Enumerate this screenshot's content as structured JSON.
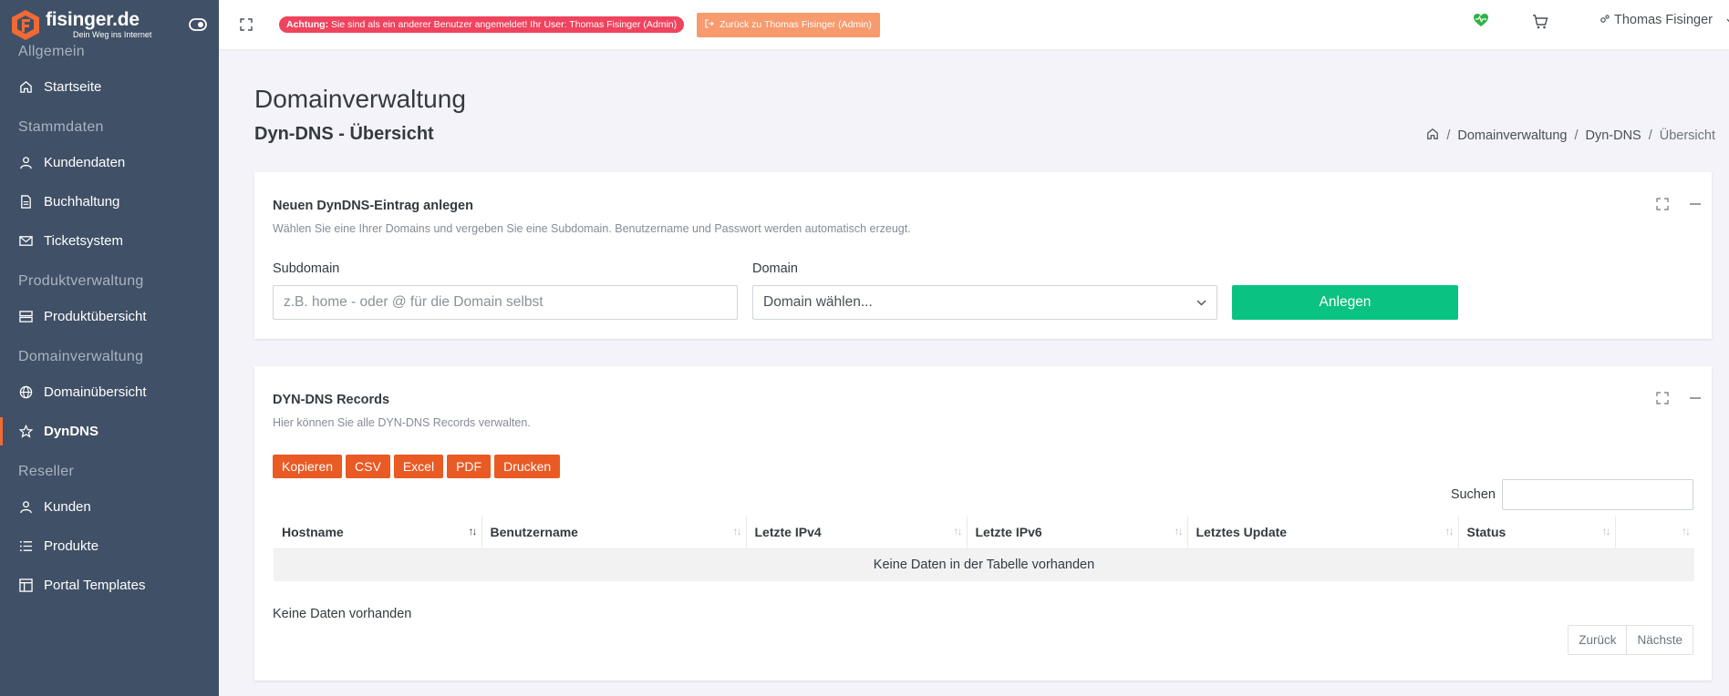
{
  "brand": {
    "name": "fisinger.de",
    "tagline": "Dein Weg ins Internet",
    "accent": "#f06a35"
  },
  "sidebar": {
    "sections": [
      {
        "title": "Allgemein",
        "items": [
          {
            "label": "Startseite",
            "icon": "home-icon"
          }
        ]
      },
      {
        "title": "Stammdaten",
        "items": [
          {
            "label": "Kundendaten",
            "icon": "user-icon"
          },
          {
            "label": "Buchhaltung",
            "icon": "file-icon"
          },
          {
            "label": "Ticketsystem",
            "icon": "mail-icon"
          }
        ]
      },
      {
        "title": "Produktverwaltung",
        "items": [
          {
            "label": "Produktübersicht",
            "icon": "server-icon"
          }
        ]
      },
      {
        "title": "Domainverwaltung",
        "items": [
          {
            "label": "Domainübersicht",
            "icon": "globe-icon"
          },
          {
            "label": "DynDNS",
            "icon": "star-icon",
            "active": true
          }
        ]
      },
      {
        "title": "Reseller",
        "items": [
          {
            "label": "Kunden",
            "icon": "user-icon"
          },
          {
            "label": "Produkte",
            "icon": "list-icon"
          },
          {
            "label": "Portal Templates",
            "icon": "layout-icon"
          }
        ]
      }
    ]
  },
  "topbar": {
    "alert_strong": "Achtung:",
    "alert_text": " Sie sind als ein anderer Benutzer angemeldet! Ihr User: Thomas Fisinger (Admin)",
    "back_label": "Zurück zu Thomas Fisinger (Admin)",
    "user_name": "Thomas Fisinger",
    "heart_color": "#2fb344"
  },
  "page": {
    "title": "Domainverwaltung",
    "subtitle": "Dyn-DNS - Übersicht",
    "breadcrumb": [
      "Domainverwaltung",
      "Dyn-DNS",
      "Übersicht"
    ]
  },
  "create_card": {
    "title": "Neuen DynDNS-Eintrag anlegen",
    "desc": "Wählen Sie eine Ihrer Domains und vergeben Sie eine Subdomain. Benutzername und Passwort werden automatisch erzeugt.",
    "subdomain_label": "Subdomain",
    "subdomain_placeholder": "z.B. home - oder @ für die Domain selbst",
    "domain_label": "Domain",
    "domain_select": "Domain wählen...",
    "submit_label": "Anlegen"
  },
  "records_card": {
    "title": "DYN-DNS Records",
    "desc": "Hier können Sie alle DYN-DNS Records verwalten.",
    "export_buttons": [
      "Kopieren",
      "CSV",
      "Excel",
      "PDF",
      "Drucken"
    ],
    "search_label": "Suchen",
    "columns": [
      "Hostname",
      "Benutzername",
      "Letzte IPv4",
      "Letzte IPv6",
      "Letztes Update",
      "Status",
      ""
    ],
    "empty_text": "Keine Daten in der Tabelle vorhanden",
    "info_text": "Keine Daten vorhanden",
    "pager_prev": "Zurück",
    "pager_next": "Nächste"
  }
}
